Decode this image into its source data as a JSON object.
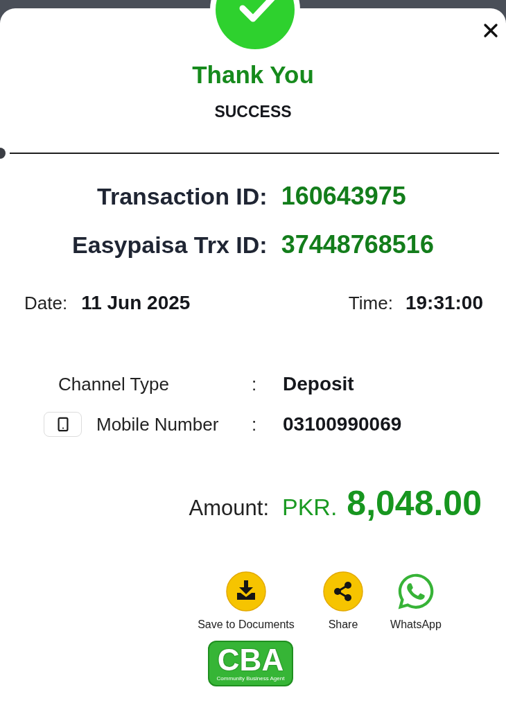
{
  "header": {
    "title": "Thank You",
    "status": "SUCCESS"
  },
  "ids": [
    {
      "label": "Transaction ID:",
      "value": "160643975"
    },
    {
      "label": "Easypaisa Trx ID:",
      "value": "37448768516"
    }
  ],
  "date": {
    "label": "Date:",
    "value": "11 Jun 2025"
  },
  "time": {
    "label": "Time:",
    "value": "19:31:00"
  },
  "details": [
    {
      "kind": "text",
      "label": "Channel Type",
      "separator": ":",
      "value": "Deposit"
    },
    {
      "kind": "phone",
      "label": "Mobile Number",
      "separator": ":",
      "value": "03100990069"
    }
  ],
  "amount": {
    "label": "Amount:",
    "currency": "PKR.",
    "value": "8,048.00"
  },
  "actions": [
    {
      "kind": "download",
      "label": "Save to Documents"
    },
    {
      "kind": "share",
      "label": "Share"
    },
    {
      "kind": "whatsapp",
      "label": "WhatsApp"
    }
  ],
  "logo": {
    "text": "CBA",
    "tagline": "Community Business Agent"
  }
}
